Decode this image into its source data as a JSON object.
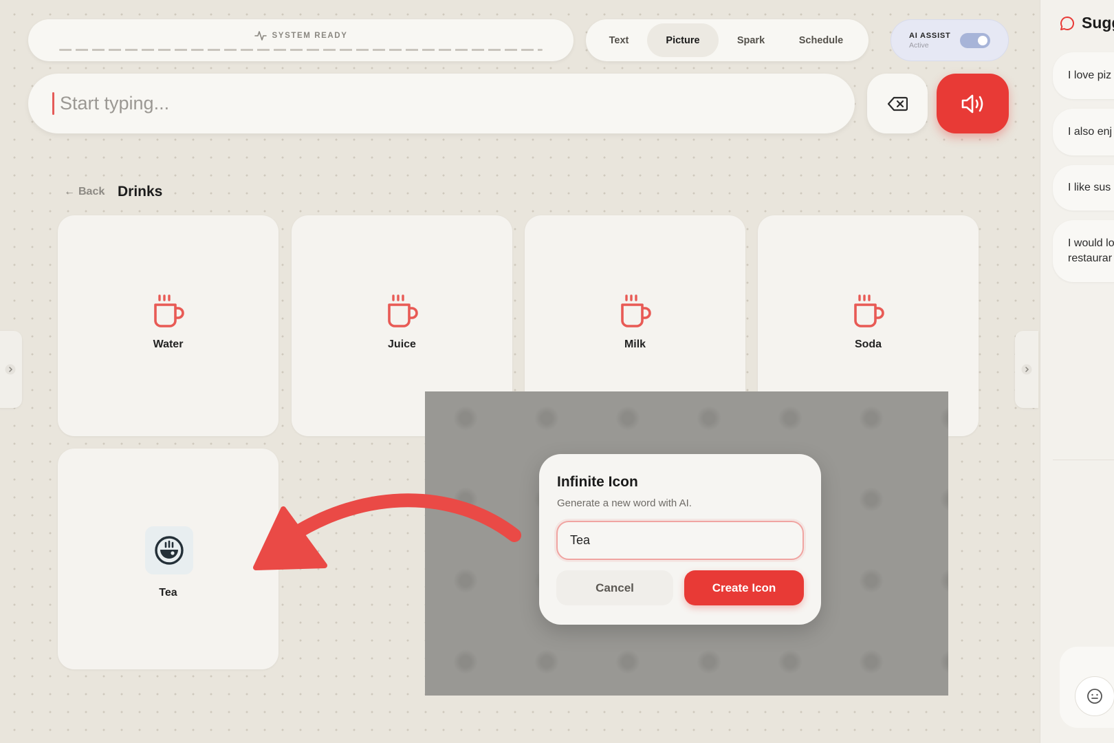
{
  "status": {
    "label": "SYSTEM READY"
  },
  "modes": {
    "tabs": [
      "Text",
      "Picture",
      "Spark",
      "Schedule"
    ],
    "active": "Picture"
  },
  "ai_assist": {
    "title": "AI ASSIST",
    "status": "Active",
    "enabled": true
  },
  "input": {
    "placeholder": "Start typing...",
    "value": ""
  },
  "breadcrumb": {
    "back_label": "Back",
    "title": "Drinks"
  },
  "cards": [
    {
      "label": "Water",
      "icon": "cup-icon"
    },
    {
      "label": "Juice",
      "icon": "cup-icon"
    },
    {
      "label": "Milk",
      "icon": "cup-icon"
    },
    {
      "label": "Soda",
      "icon": "cup-icon"
    },
    {
      "label": "Tea",
      "icon": "tea-bowl-icon"
    }
  ],
  "suggestions": {
    "title": "Sugg",
    "items": [
      "I love piz",
      "I also enj",
      "I like sus",
      "I would lo restaurar"
    ]
  },
  "modal": {
    "title": "Infinite Icon",
    "subtitle": "Generate a new word with AI.",
    "input_value": "Tea",
    "cancel_label": "Cancel",
    "create_label": "Create Icon"
  },
  "colors": {
    "accent": "#e83a36",
    "background": "#e9e5dc",
    "card": "#f5f3ef",
    "icon_red": "#e85a55",
    "tea_icon": "#243038"
  }
}
